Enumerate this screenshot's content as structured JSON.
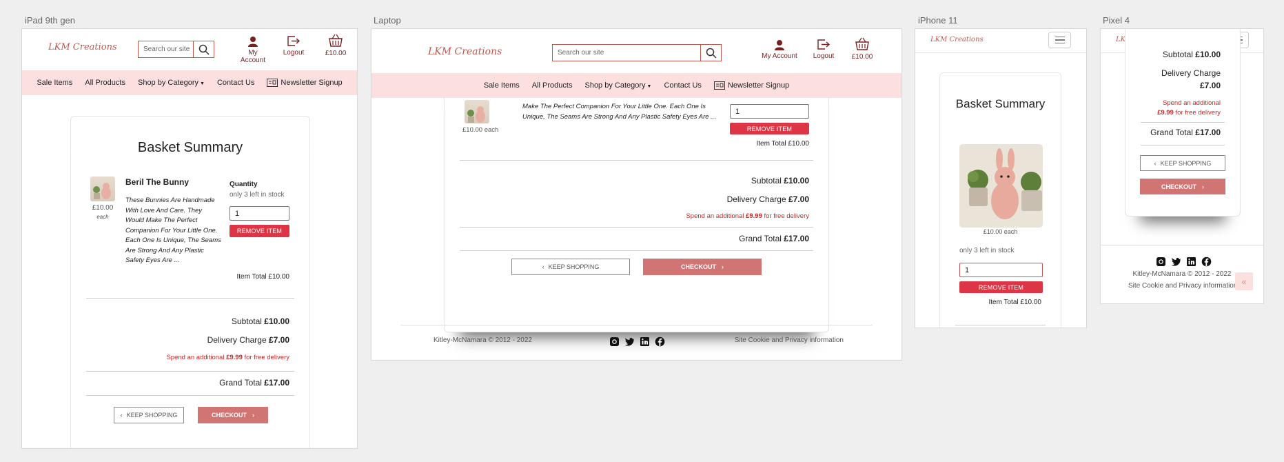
{
  "devices": {
    "ipad": "iPad 9th gen",
    "laptop": "Laptop",
    "iphone": "iPhone 11",
    "pixel": "Pixel 4"
  },
  "brand": "LKM Creations",
  "search_placeholder": "Search our site",
  "search_placeholder_short": "Search our site",
  "header": {
    "account": "My Account",
    "logout": "Logout",
    "basket_total": "£10.00"
  },
  "nav": {
    "sale": "Sale Items",
    "all": "All Products",
    "category": "Shop by Category",
    "contact": "Contact Us",
    "newsletter": "Newsletter Signup"
  },
  "basket": {
    "title": "Basket Summary",
    "product_name": "Beril The Bunny",
    "price_each": "£10.00",
    "each": "each",
    "price_each_inline": "£10.00 each",
    "description": "These Bunnies Are Handmade With Love And Care. They Would Make The Perfect Companion For Your Little One. Each One Is Unique, The Seams Are Strong And Any Plastic Safety Eyes Are ...",
    "desc_laptop_1": "Make The Perfect Companion For Your Little One. Each One Is",
    "desc_laptop_2": "Unique, The Seams Are Strong And Any Plastic Safety Eyes Are ...",
    "quantity_label": "Quantity",
    "stock": "only 3 left in stock",
    "quantity": "1",
    "remove": "REMOVE ITEM",
    "item_total": "Item Total £10.00",
    "subtotal_label": "Subtotal",
    "subtotal": "£10.00",
    "delivery_label": "Delivery Charge",
    "delivery": "£7.00",
    "spend_pre": "Spend an additional",
    "spend_amount": "£9.99",
    "spend_post": "for free delivery",
    "grand_label": "Grand Total",
    "grand": "£17.00",
    "keep": "KEEP SHOPPING",
    "checkout": "CHECKOUT"
  },
  "footer": {
    "copyright": "Kitley-McNamara © 2012 - 2022",
    "cookie": "Site Cookie and Privacy information"
  },
  "colors": {
    "accent": "#c0574f",
    "nav_bg": "#fce0e0",
    "danger": "#dc3545",
    "checkout": "#d07474",
    "account_icon": "#7a1f1f"
  },
  "icons": [
    "search-icon",
    "account-icon",
    "logout-icon",
    "basket-icon",
    "newsletter-icon",
    "chevron-left-icon",
    "chevron-right-icon",
    "github-icon",
    "twitter-icon",
    "linkedin-icon",
    "facebook-icon",
    "hamburger-icon",
    "scroll-top-icon"
  ]
}
